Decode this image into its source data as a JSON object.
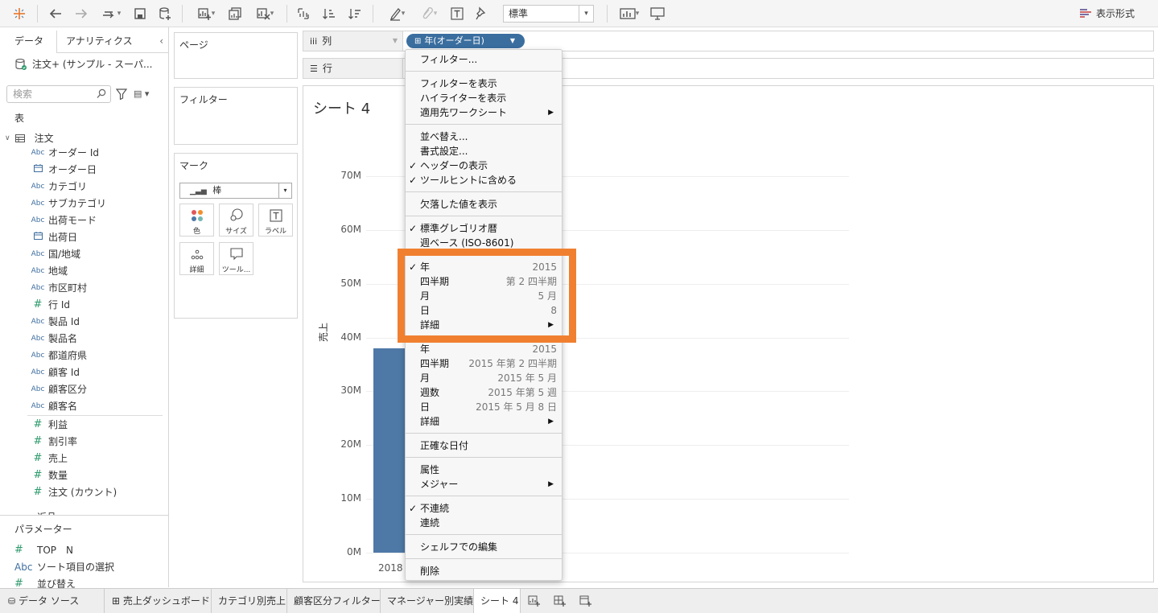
{
  "toolbar": {
    "size_select": "標準",
    "show_me_label": "表示形式"
  },
  "data_pane": {
    "tabs": [
      "データ",
      "アナリティクス"
    ],
    "datasource": "注文+ (サンプル - スーパ...",
    "search_placeholder": "検索",
    "tables_heading": "表",
    "table_name": "注文",
    "dimensions": [
      {
        "type": "Abc",
        "name": "オーダー Id"
      },
      {
        "type": "date",
        "name": "オーダー日"
      },
      {
        "type": "Abc",
        "name": "カテゴリ"
      },
      {
        "type": "Abc",
        "name": "サブカテゴリ"
      },
      {
        "type": "Abc",
        "name": "出荷モード"
      },
      {
        "type": "date",
        "name": "出荷日"
      },
      {
        "type": "Abc",
        "name": "国/地域"
      },
      {
        "type": "Abc",
        "name": "地域"
      },
      {
        "type": "Abc",
        "name": "市区町村"
      },
      {
        "type": "#",
        "name": "行 Id"
      },
      {
        "type": "Abc",
        "name": "製品 Id"
      },
      {
        "type": "Abc",
        "name": "製品名"
      },
      {
        "type": "Abc",
        "name": "都道府県"
      },
      {
        "type": "Abc",
        "name": "顧客 Id"
      },
      {
        "type": "Abc",
        "name": "顧客区分"
      },
      {
        "type": "Abc",
        "name": "顧客名"
      }
    ],
    "measures": [
      {
        "type": "#",
        "name": "利益"
      },
      {
        "type": "#",
        "name": "割引率"
      },
      {
        "type": "#",
        "name": "売上"
      },
      {
        "type": "#",
        "name": "数量"
      },
      {
        "type": "#",
        "name": "注文 (カウント)"
      }
    ],
    "cut_item": "返品",
    "parameters_heading": "パラメーター",
    "parameters": [
      {
        "type": "#",
        "name": "TOP　N"
      },
      {
        "type": "Abc",
        "name": "ソート項目の選択"
      },
      {
        "type": "#",
        "name": "並び替え"
      }
    ]
  },
  "cards": {
    "pages": "ページ",
    "filters": "フィルター",
    "marks": "マーク",
    "mark_type": "棒",
    "mark_buttons": [
      "色",
      "サイズ",
      "ラベル",
      "詳細",
      "ツール..."
    ]
  },
  "shelves": {
    "columns_label": "列",
    "rows_label": "行",
    "column_pill": "年(オーダー日)"
  },
  "view": {
    "sheet_title": "シート 4"
  },
  "chart_data": {
    "type": "bar",
    "title": "シート 4",
    "xlabel": "",
    "ylabel": "売上",
    "categories": [
      "2018"
    ],
    "values": [
      38000000
    ],
    "ylim": [
      0,
      70000000
    ],
    "yticks": [
      "0M",
      "10M",
      "20M",
      "30M",
      "40M",
      "50M",
      "60M",
      "70M"
    ],
    "grid": true,
    "color": "#4e79a7"
  },
  "context_menu": {
    "items": [
      {
        "label": "フィルター...",
        "check": false,
        "submenu": false,
        "value": ""
      },
      {
        "sep": true
      },
      {
        "label": "フィルターを表示",
        "check": false,
        "submenu": false,
        "value": ""
      },
      {
        "label": "ハイライターを表示",
        "check": false,
        "submenu": false,
        "value": ""
      },
      {
        "label": "適用先ワークシート",
        "check": false,
        "submenu": true,
        "value": ""
      },
      {
        "sep": true
      },
      {
        "label": "並べ替え...",
        "check": false,
        "submenu": false,
        "value": ""
      },
      {
        "label": "書式設定...",
        "check": false,
        "submenu": false,
        "value": ""
      },
      {
        "label": "ヘッダーの表示",
        "check": true,
        "submenu": false,
        "value": ""
      },
      {
        "label": "ツールヒントに含める",
        "check": true,
        "submenu": false,
        "value": ""
      },
      {
        "sep": true
      },
      {
        "label": "欠落した値を表示",
        "check": false,
        "submenu": false,
        "value": ""
      },
      {
        "sep": true
      },
      {
        "label": "標準グレゴリオ暦",
        "check": true,
        "submenu": false,
        "value": ""
      },
      {
        "label": "週ベース (ISO-8601)",
        "check": false,
        "submenu": false,
        "value": ""
      },
      {
        "sep": true
      },
      {
        "label": "年",
        "check": true,
        "submenu": false,
        "value": "2015"
      },
      {
        "label": "四半期",
        "check": false,
        "submenu": false,
        "value": "第 2 四半期"
      },
      {
        "label": "月",
        "check": false,
        "submenu": false,
        "value": "5 月"
      },
      {
        "label": "日",
        "check": false,
        "submenu": false,
        "value": "8"
      },
      {
        "label": "詳細",
        "check": false,
        "submenu": true,
        "value": ""
      },
      {
        "sep": true
      },
      {
        "label": "年",
        "check": false,
        "submenu": false,
        "value": "2015"
      },
      {
        "label": "四半期",
        "check": false,
        "submenu": false,
        "value": "2015 年第 2 四半期"
      },
      {
        "label": "月",
        "check": false,
        "submenu": false,
        "value": "2015 年 5 月"
      },
      {
        "label": "週数",
        "check": false,
        "submenu": false,
        "value": "2015 年第 5 週"
      },
      {
        "label": "日",
        "check": false,
        "submenu": false,
        "value": "2015 年 5 月 8 日"
      },
      {
        "label": "詳細",
        "check": false,
        "submenu": true,
        "value": ""
      },
      {
        "sep": true
      },
      {
        "label": "正確な日付",
        "check": false,
        "submenu": false,
        "value": ""
      },
      {
        "sep": true
      },
      {
        "label": "属性",
        "check": false,
        "submenu": false,
        "value": ""
      },
      {
        "label": "メジャー",
        "check": false,
        "submenu": true,
        "value": ""
      },
      {
        "sep": true
      },
      {
        "label": "不連続",
        "check": true,
        "submenu": false,
        "value": ""
      },
      {
        "label": "連続",
        "check": false,
        "submenu": false,
        "value": ""
      },
      {
        "sep": true
      },
      {
        "label": "シェルフでの編集",
        "check": false,
        "submenu": false,
        "value": ""
      },
      {
        "sep": true
      },
      {
        "label": "削除",
        "check": false,
        "submenu": false,
        "value": ""
      }
    ],
    "highlight_color": "#f08030"
  },
  "bottom_tabs": {
    "datasource": "データ ソース",
    "sheets": [
      "売上ダッシュボード",
      "カテゴリ別売上",
      "顧客区分フィルター",
      "マネージャー別実績",
      "シート 4"
    ],
    "active": "シート 4"
  }
}
